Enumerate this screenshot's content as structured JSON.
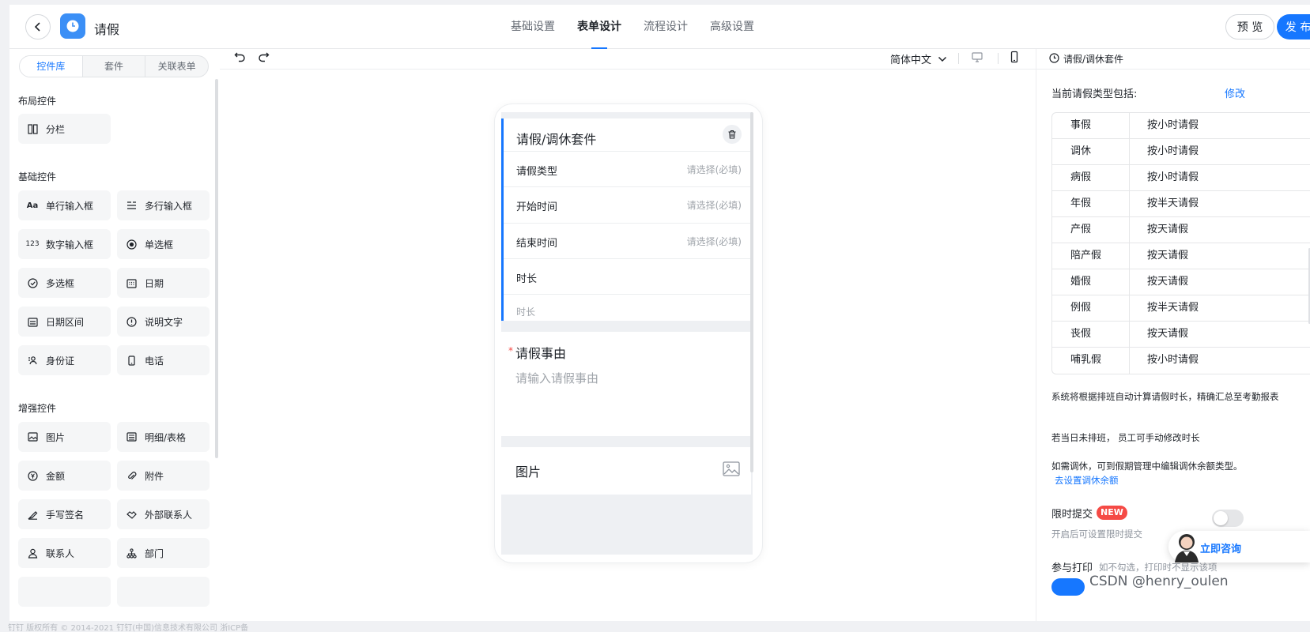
{
  "header": {
    "title": "请假",
    "tabs": [
      "基础设置",
      "表单设计",
      "流程设计",
      "高级设置"
    ],
    "active_tab": 1,
    "preview_label": "预 览",
    "publish_label": "发 布"
  },
  "left_panel": {
    "segments": [
      "控件库",
      "套件",
      "关联表单"
    ],
    "active_segment": 0,
    "groups": [
      {
        "title": "布局控件",
        "items": [
          {
            "label": "分栏",
            "icon": "columns-icon"
          }
        ]
      },
      {
        "title": "基础控件",
        "items": [
          {
            "label": "单行输入框",
            "icon": "text-aa-icon"
          },
          {
            "label": "多行输入框",
            "icon": "multiline-text-icon"
          },
          {
            "label": "数字输入框",
            "icon": "number-123-icon"
          },
          {
            "label": "单选框",
            "icon": "radio-icon"
          },
          {
            "label": "多选框",
            "icon": "checkbox-circle-icon"
          },
          {
            "label": "日期",
            "icon": "calendar-icon"
          },
          {
            "label": "日期区间",
            "icon": "date-range-icon"
          },
          {
            "label": "说明文字",
            "icon": "info-icon"
          },
          {
            "label": "身份证",
            "icon": "id-card-icon"
          },
          {
            "label": "电话",
            "icon": "phone-icon"
          }
        ]
      },
      {
        "title": "增强控件",
        "items": [
          {
            "label": "图片",
            "icon": "image-icon"
          },
          {
            "label": "明细/表格",
            "icon": "table-icon"
          },
          {
            "label": "金额",
            "icon": "money-icon"
          },
          {
            "label": "附件",
            "icon": "paperclip-icon"
          },
          {
            "label": "手写签名",
            "icon": "signature-icon"
          },
          {
            "label": "外部联系人",
            "icon": "handshake-icon"
          },
          {
            "label": "联系人",
            "icon": "person-icon"
          },
          {
            "label": "部门",
            "icon": "org-chart-icon"
          }
        ]
      }
    ]
  },
  "canvas": {
    "language": "简体中文",
    "kit": {
      "title": "请假/调休套件",
      "fields": [
        {
          "label": "请假类型",
          "placeholder": "请选择(必填)"
        },
        {
          "label": "开始时间",
          "placeholder": "请选择(必填)"
        },
        {
          "label": "结束时间",
          "placeholder": "请选择(必填)"
        },
        {
          "label": "时长",
          "placeholder": ""
        }
      ],
      "duration_sub": "时长"
    },
    "reason": {
      "required_mark": "*",
      "label": "请假事由",
      "placeholder": "请输入请假事由"
    },
    "picture": {
      "label": "图片"
    }
  },
  "right_panel": {
    "header_title": "请假/调休套件",
    "types_label": "当前请假类型包括:",
    "edit_label": "修改",
    "leave_types": [
      {
        "name": "事假",
        "unit": "按小时请假"
      },
      {
        "name": "调休",
        "unit": "按小时请假"
      },
      {
        "name": "病假",
        "unit": "按小时请假"
      },
      {
        "name": "年假",
        "unit": "按半天请假"
      },
      {
        "name": "产假",
        "unit": "按天请假"
      },
      {
        "name": "陪产假",
        "unit": "按天请假"
      },
      {
        "name": "婚假",
        "unit": "按天请假"
      },
      {
        "name": "例假",
        "unit": "按半天请假"
      },
      {
        "name": "丧假",
        "unit": "按天请假"
      },
      {
        "name": "哺乳假",
        "unit": "按小时请假"
      }
    ],
    "note1": "系统将根据排班自动计算请假时长，精确汇总至考勤报表",
    "note2": "若当日未排班， 员工可手动修改时长",
    "note3": "如需调休，可到假期管理中编辑调休余额类型。",
    "note3_link": "去设置调休余额",
    "limit_label": "限时提交",
    "new_badge": "NEW",
    "limit_sub": "开启后可设置限时提交",
    "limit_enabled": false,
    "print_label": "参与打印",
    "print_sub": "如不勾选，打印时不显示该项",
    "print_enabled": true
  },
  "consult": {
    "label": "立即咨询"
  },
  "footer": {
    "text": "钉钉 版权所有 © 2014-2021 钉钉(中国)信息技术有限公司 浙ICP备"
  },
  "watermark": "CSDN @henry_oulen",
  "colors": {
    "accent": "#1677ff",
    "danger": "#f54a45",
    "muted": "#a0a5ab"
  }
}
